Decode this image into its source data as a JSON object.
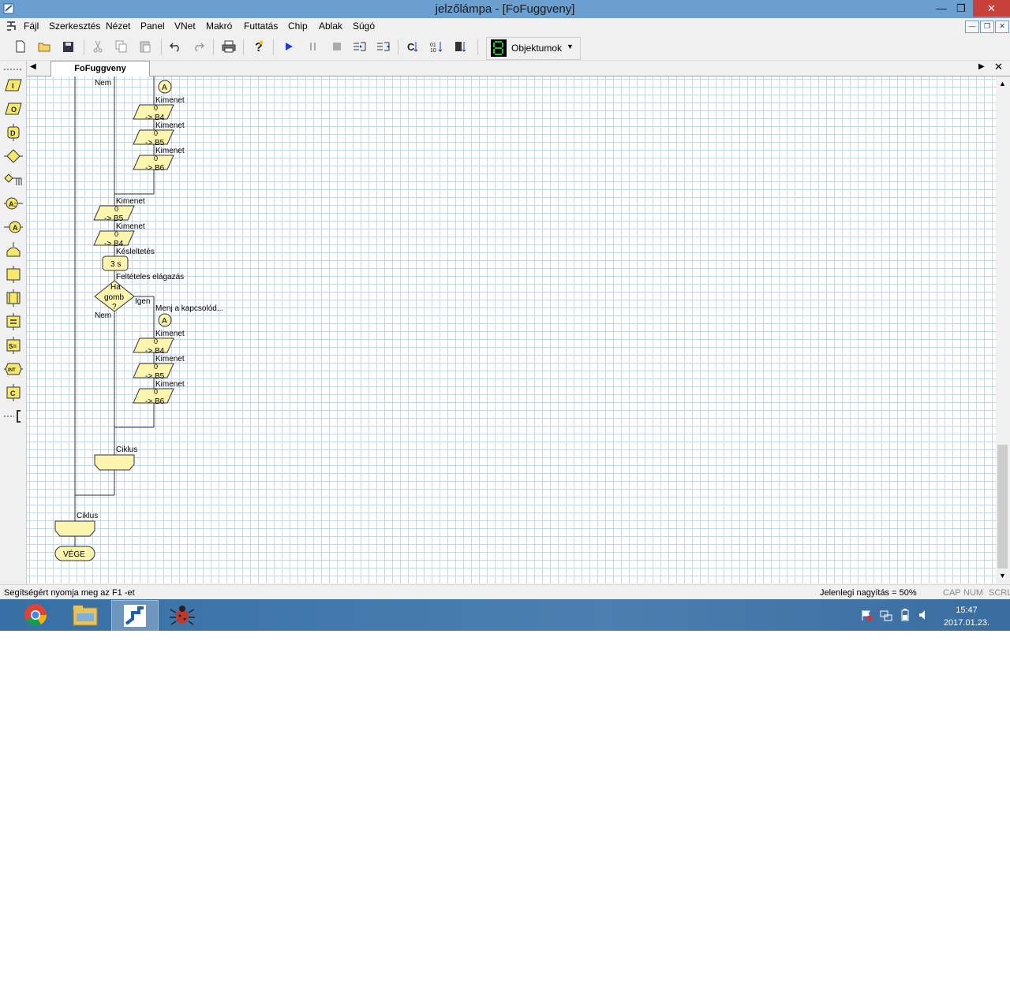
{
  "window": {
    "title": "jelzőlámpa - [FoFuggveny]"
  },
  "menu": [
    "Fájl",
    "Szerkesztés",
    "Nézet",
    "Panel",
    "VNet",
    "Makró",
    "Futtatás",
    "Chip",
    "Ablak",
    "Súgó"
  ],
  "toolbar": {
    "objects_label": "Objektumok"
  },
  "tab": {
    "label": "FoFuggveny"
  },
  "flowchart": {
    "nem1": "Nem",
    "connector_a": "A",
    "kimenet": "Kimenet",
    "out_b4": "-> B4",
    "out_b5": "-> B5",
    "out_b6": "-> B6",
    "zero": "0",
    "kesleltetes": "Késleltetés",
    "delay_value": "3 s",
    "felteteles": "Feltételes elágazás",
    "cond_line1": "Ha",
    "cond_line2": "gomb",
    "cond_line3": "?",
    "igen": "Igen",
    "nem2": "Nem",
    "menj": "Menj a kapcsolód...",
    "ciklus": "Ciklus",
    "vege": "VÉGE"
  },
  "status": {
    "help": "Segítségért nyomja meg az F1 -et",
    "zoom": "Jelenlegi nagyítás = 50%",
    "cap": "CAP",
    "num": "NUM",
    "scrl": "SCRL"
  },
  "taskbar": {
    "apps": [
      "chrome-icon",
      "file-explorer-icon",
      "flowcode-icon",
      "bug-app-icon"
    ],
    "time": "15:47",
    "date": "2017.01.23."
  }
}
